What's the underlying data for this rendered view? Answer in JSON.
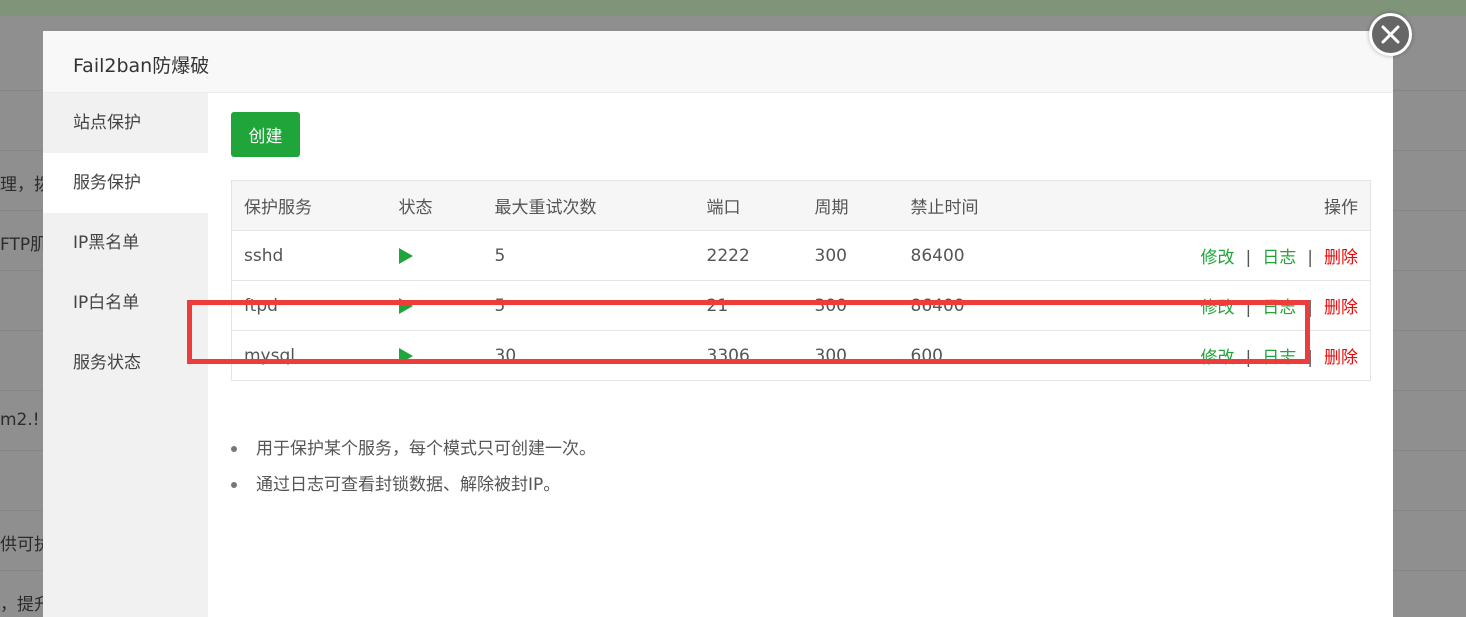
{
  "background": {
    "fragments": [
      "理，拨",
      "FTP肌",
      "m2.!",
      "供可执",
      "，提升"
    ]
  },
  "modal": {
    "title": "Fail2ban防爆破",
    "close_icon": "close-icon"
  },
  "sidebar": {
    "items": [
      {
        "label": "站点保护",
        "active": false
      },
      {
        "label": "服务保护",
        "active": true
      },
      {
        "label": "IP黑名单",
        "active": false
      },
      {
        "label": "IP白名单",
        "active": false
      },
      {
        "label": "服务状态",
        "active": false
      }
    ]
  },
  "toolbar": {
    "create_label": "创建"
  },
  "table": {
    "headers": [
      "保护服务",
      "状态",
      "最大重试次数",
      "端口",
      "周期",
      "禁止时间",
      "操作"
    ],
    "rows": [
      {
        "service": "sshd",
        "status_icon": "play-icon",
        "max_retry": "5",
        "port": "2222",
        "period": "300",
        "ban_time": "86400",
        "edit": "修改",
        "log": "日志",
        "delete": "删除"
      },
      {
        "service": "ftpd",
        "status_icon": "play-icon",
        "max_retry": "5",
        "port": "21",
        "period": "300",
        "ban_time": "86400",
        "edit": "修改",
        "log": "日志",
        "delete": "删除"
      },
      {
        "service": "mysql",
        "status_icon": "play-icon",
        "max_retry": "30",
        "port": "3306",
        "period": "300",
        "ban_time": "600",
        "edit": "修改",
        "log": "日志",
        "delete": "删除"
      }
    ],
    "separator": "|"
  },
  "tips": [
    "用于保护某个服务，每个模式只可创建一次。",
    "通过日志可查看封锁数据、解除被封IP。"
  ],
  "colors": {
    "accent": "#20a53a",
    "danger": "#ef0808",
    "highlight": "#ee3b3b"
  }
}
